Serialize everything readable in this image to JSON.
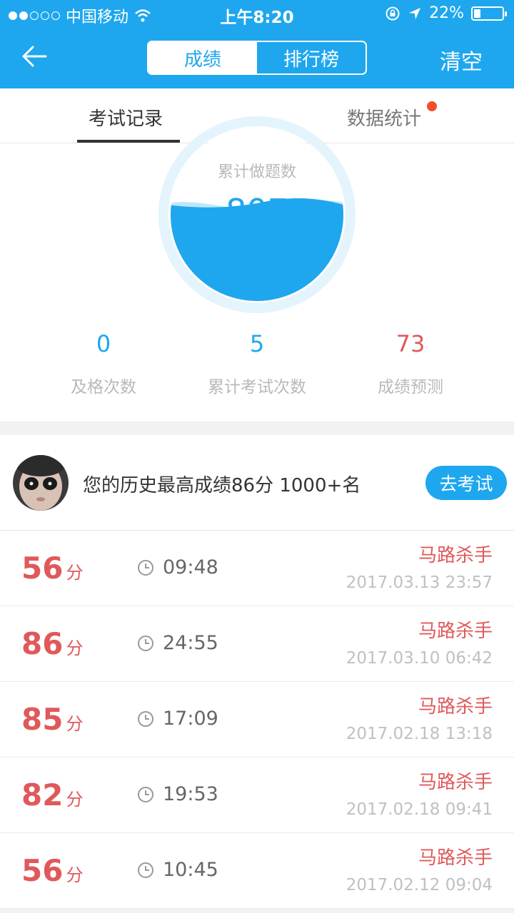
{
  "status_bar": {
    "carrier": "中国移动",
    "time": "上午8:20",
    "battery": "22%"
  },
  "nav": {
    "segments": [
      "成绩",
      "排行榜"
    ],
    "clear_label": "清空"
  },
  "tabs": {
    "exam_records": "考试记录",
    "data_stats": "数据统计"
  },
  "stats": {
    "gauge_label": "累计做题数",
    "gauge_value": "807",
    "summary": [
      {
        "value": "0",
        "label": "及格次数"
      },
      {
        "value": "5",
        "label": "累计考试次数"
      },
      {
        "value": "73",
        "label": "成绩预测"
      }
    ]
  },
  "best": {
    "text": "您的历史最高成绩86分  1000+名",
    "button": "去考试"
  },
  "records": [
    {
      "score": "56",
      "unit": "分",
      "duration": "09:48",
      "tag": "马路杀手",
      "date": "2017.03.13 23:57"
    },
    {
      "score": "86",
      "unit": "分",
      "duration": "24:55",
      "tag": "马路杀手",
      "date": "2017.03.10 06:42"
    },
    {
      "score": "85",
      "unit": "分",
      "duration": "17:09",
      "tag": "马路杀手",
      "date": "2017.02.18 13:18"
    },
    {
      "score": "82",
      "unit": "分",
      "duration": "19:53",
      "tag": "马路杀手",
      "date": "2017.02.18 09:41"
    },
    {
      "score": "56",
      "unit": "分",
      "duration": "10:45",
      "tag": "马路杀手",
      "date": "2017.02.12 09:04"
    }
  ],
  "colors": {
    "brand_blue": "#1ea7ee",
    "score_red": "#e0595a",
    "notification_red": "#f1502b"
  },
  "icons": [
    "signal-dots-icon",
    "wifi-icon",
    "rotation-lock-icon",
    "location-arrow-icon",
    "battery-icon",
    "back-arrow-icon",
    "clock-icon"
  ]
}
